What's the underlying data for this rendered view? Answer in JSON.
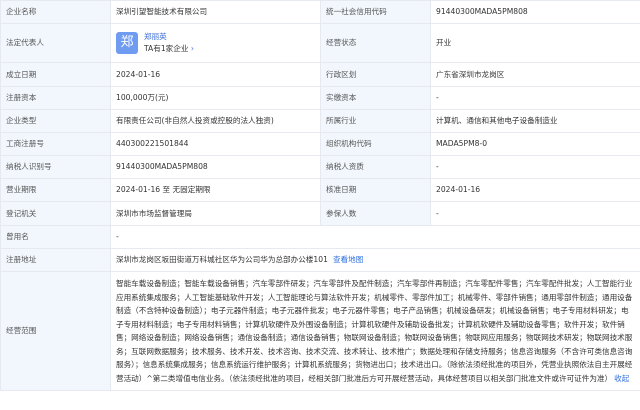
{
  "rows": {
    "name": {
      "label": "企业名称",
      "value": "深圳引望智能技术有限公司"
    },
    "credit_code": {
      "label": "统一社会信用代码",
      "value": "91440300MADA5PM808"
    },
    "legal_rep": {
      "label": "法定代表人",
      "avatar_char": "郑",
      "name": "郑丽英",
      "sub": "TA有1家企业",
      "sub_chevron": "›"
    },
    "status": {
      "label": "经营状态",
      "value": "开业"
    },
    "established": {
      "label": "成立日期",
      "value": "2024-01-16"
    },
    "region": {
      "label": "行政区划",
      "value": "广东省深圳市龙岗区"
    },
    "capital": {
      "label": "注册资本",
      "value": "100,000万(元)"
    },
    "paid_capital": {
      "label": "实缴资本",
      "value": "-"
    },
    "company_type": {
      "label": "企业类型",
      "value": "有限责任公司(非自然人投资或控股的法人独资)"
    },
    "industry": {
      "label": "所属行业",
      "value": "计算机、通信和其他电子设备制造业"
    },
    "reg_no": {
      "label": "工商注册号",
      "value": "440300221501844"
    },
    "org_code": {
      "label": "组织机构代码",
      "value": "MADA5PM8-0"
    },
    "taxpayer_id": {
      "label": "纳税人识别号",
      "value": "91440300MADA5PM808"
    },
    "taxpayer_qual": {
      "label": "纳税人资质",
      "value": "-"
    },
    "term": {
      "label": "营业期限",
      "value": "2024-01-16 至 无固定期限"
    },
    "approval_date": {
      "label": "核准日期",
      "value": "2024-01-16"
    },
    "authority": {
      "label": "登记机关",
      "value": "深圳市市场监督管理局"
    },
    "insured": {
      "label": "参保人数",
      "value": "-"
    },
    "former_name": {
      "label": "曾用名",
      "value": "-"
    },
    "address": {
      "label": "注册地址",
      "value": "深圳市龙岗区坂田街道万科城社区华为公司华为总部办公楼101",
      "map_link": "查看地图"
    },
    "scope": {
      "label": "经营范围",
      "value": "智能车载设备制造；智能车载设备销售；汽车零部件研发；汽车零部件及配件制造；汽车零部件再制造；汽车零配件零售；汽车零配件批发；人工智能行业应用系统集成服务；人工智能基础软件开发；人工智能理论与算法软件开发；机械零件、零部件加工；机械零件、零部件销售；通用零部件制造；通用设备制造（不含特种设备制造）；电子元器件制造；电子元器件批发；电子元器件零售；电子产品销售；机械设备研发；机械设备销售；电子专用材料研发；电子专用材料制造；电子专用材料销售；计算机软硬件及外围设备制造；计算机软硬件及辅助设备批发；计算机软硬件及辅助设备零售；软件开发；软件销售；网络设备制造；网络设备销售；通信设备制造；通信设备销售；物联网设备制造；物联网设备销售；物联网应用服务；物联网技术研发；物联网技术服务；互联网数据服务；技术服务、技术开发、技术咨询、技术交流、技术转让、技术推广；数据处理和存储支持服务；信息咨询服务（不含许可类信息咨询服务）；信息系统集成服务；信息系统运行维护服务；计算机系统服务；货物进出口；技术进出口。（除依法须经批准的项目外，凭营业执照依法自主开展经营活动）^第二类增值电信业务。（依法须经批准的项目，经相关部门批准后方可开展经营活动，具体经营项目以相关部门批准文件或许可证件为准）",
      "collapse_link": "收起"
    }
  }
}
